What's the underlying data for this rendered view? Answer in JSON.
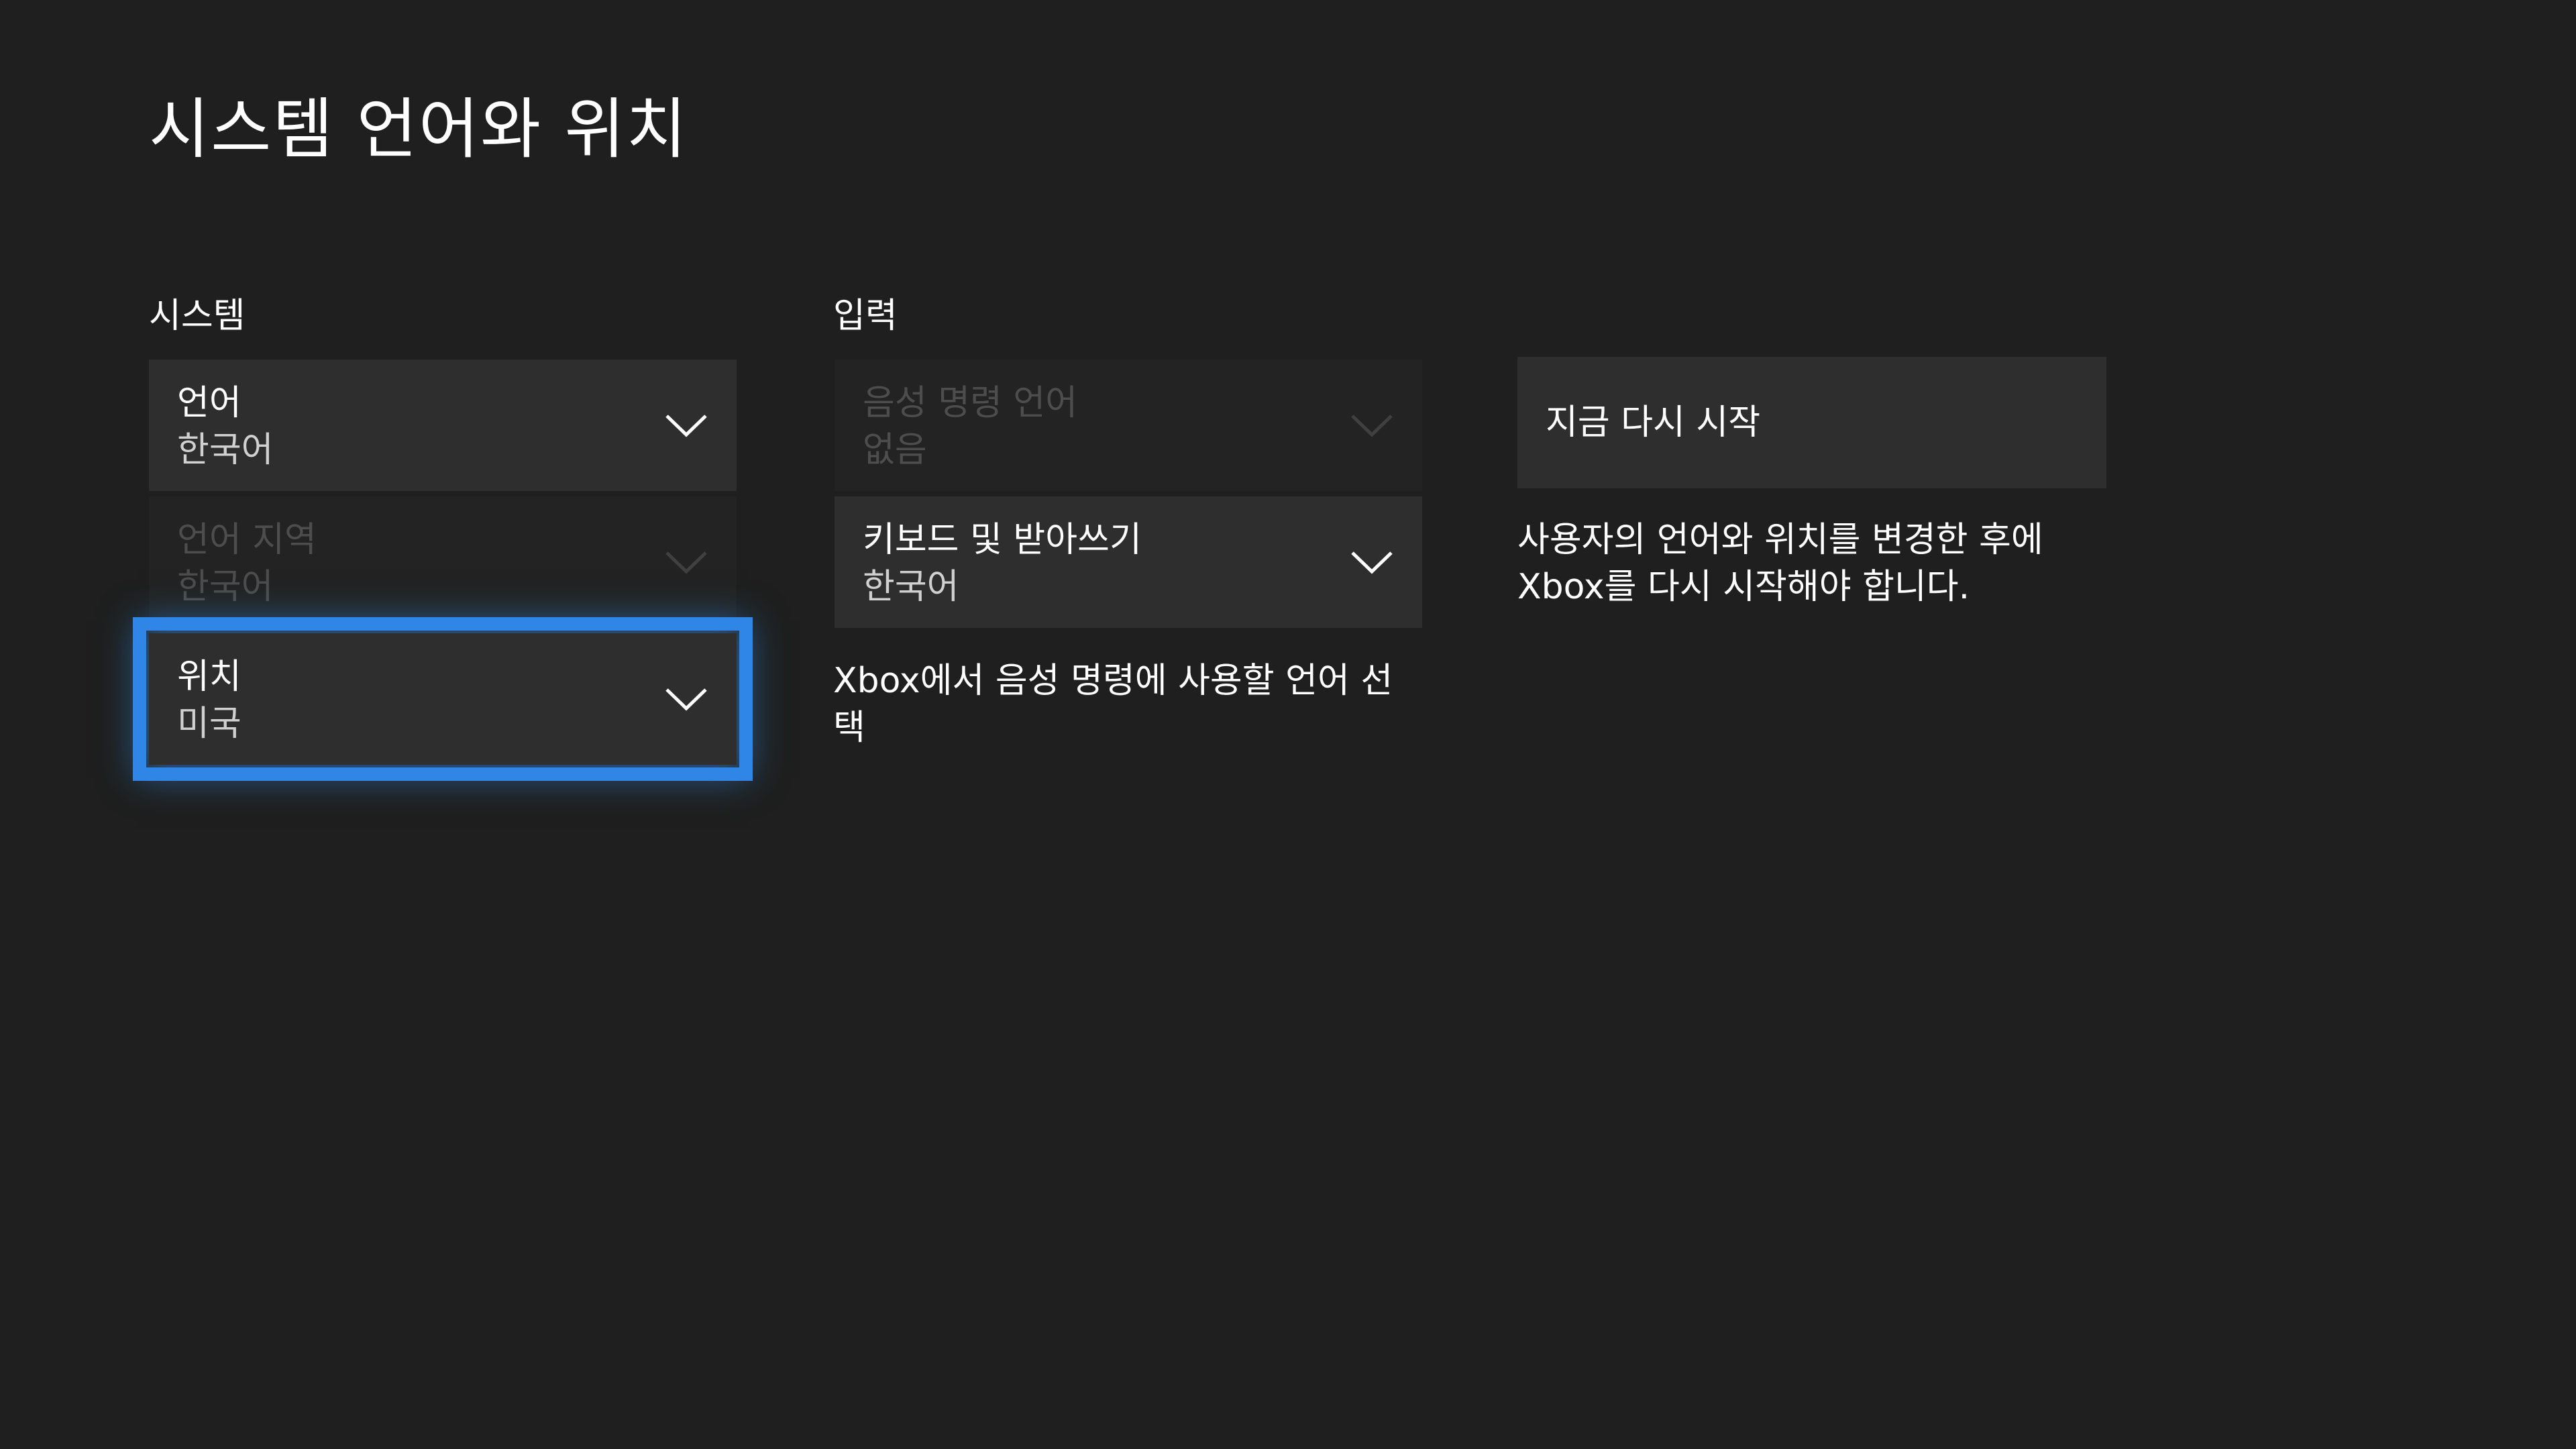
{
  "header": {
    "title": "시스템 언어와 위치"
  },
  "system": {
    "heading": "시스템",
    "language": {
      "label": "언어",
      "value": "한국어"
    },
    "language_region": {
      "label": "언어 지역",
      "value": "한국어"
    },
    "location": {
      "label": "위치",
      "value": "미국"
    }
  },
  "input": {
    "heading": "입력",
    "speech_language": {
      "label": "음성 명령 언어",
      "value": "없음"
    },
    "keyboard": {
      "label": "키보드 및 받아쓰기",
      "value": "한국어"
    },
    "description": "Xbox에서 음성 명령에 사용할 언어 선택"
  },
  "restart": {
    "button_label": "지금 다시 시작",
    "note": "사용자의 언어와 위치를 변경한 후에 Xbox를 다시 시작해야 합니다."
  },
  "colors": {
    "background": "#1e1f1e",
    "tile": "#2d2e2d",
    "focus_accent": "#2f86e6",
    "disabled_text": "#4c4d4c"
  },
  "icons": {
    "dropdown_indicator": "chevron-down-icon"
  }
}
